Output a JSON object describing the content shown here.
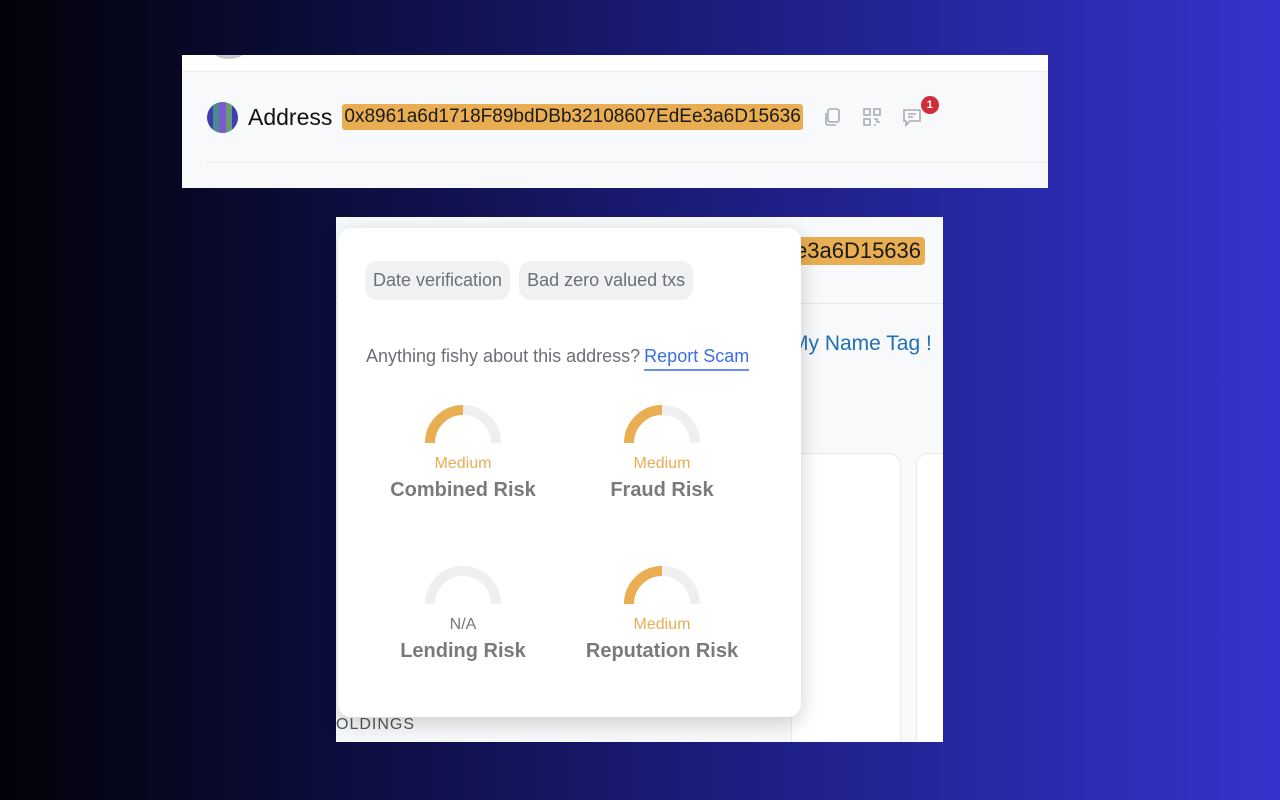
{
  "header": {
    "title": "Address",
    "address": "0x8961a6d1718F89bdDBb32108607EdEe3a6D15636",
    "notification_count": "1",
    "icons": [
      "copy-icon",
      "qr-code-icon",
      "comment-icon"
    ]
  },
  "background_page": {
    "address_fragment": "e3a6D15636",
    "name_tag_link": "My Name Tag !",
    "section_label": "OLDINGS"
  },
  "popup": {
    "chips": [
      "Date verification",
      "Bad zero valued txs"
    ],
    "fishy_prompt": "Anything fishy about this address?",
    "report_link": "Report Scam",
    "gauges": [
      {
        "name": "Combined Risk",
        "level": "Medium",
        "fill": 0.5,
        "color": "#e9ae52"
      },
      {
        "name": "Fraud Risk",
        "level": "Medium",
        "fill": 0.5,
        "color": "#e9ae52"
      },
      {
        "name": "Lending Risk",
        "level": "N/A",
        "fill": 0,
        "color": "#777777"
      },
      {
        "name": "Reputation Risk",
        "level": "Medium",
        "fill": 0.5,
        "color": "#e9ae52"
      }
    ]
  },
  "colors": {
    "highlight": "#e9ae52",
    "link": "#3b6ee6",
    "badge": "#d12d3b"
  }
}
